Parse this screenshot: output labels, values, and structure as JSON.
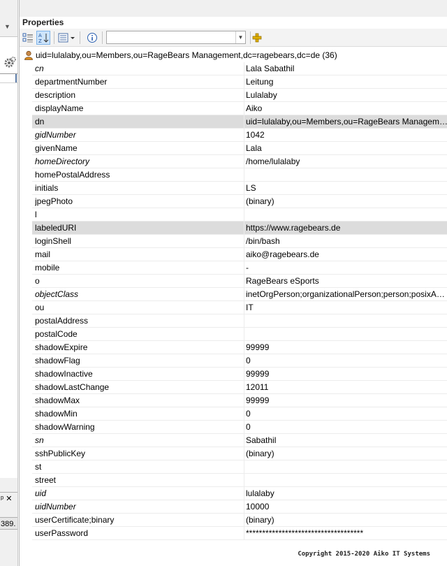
{
  "left_panel": {
    "pin_label": "ᵖ ✕",
    "status_text": "389."
  },
  "panel": {
    "title": "Properties",
    "entry_dn": "uid=lulalaby,ou=Members,ou=RageBears Management,dc=ragebears,dc=de (36)",
    "search_placeholder": ""
  },
  "attributes": [
    {
      "name": "cn",
      "value": "Lala Sabathil",
      "italic": true
    },
    {
      "name": "departmentNumber",
      "value": "Leitung"
    },
    {
      "name": "description",
      "value": "Lulalaby"
    },
    {
      "name": "displayName",
      "value": "Aiko"
    },
    {
      "name": "dn",
      "value": "uid=lulalaby,ou=Members,ou=RageBears Manageme...",
      "selected": true
    },
    {
      "name": "gidNumber",
      "value": "1042",
      "italic": true
    },
    {
      "name": "givenName",
      "value": "Lala"
    },
    {
      "name": "homeDirectory",
      "value": "/home/lulalaby",
      "italic": true
    },
    {
      "name": "homePostalAddress",
      "value": ""
    },
    {
      "name": "initials",
      "value": "LS"
    },
    {
      "name": "jpegPhoto",
      "value": "(binary)"
    },
    {
      "name": "l",
      "value": ""
    },
    {
      "name": "labeledURI",
      "value": "https://www.ragebears.de",
      "selected": true
    },
    {
      "name": "loginShell",
      "value": "/bin/bash"
    },
    {
      "name": "mail",
      "value": "aiko@ragebears.de"
    },
    {
      "name": "mobile",
      "value": "-"
    },
    {
      "name": "o",
      "value": "RageBears eSports"
    },
    {
      "name": "objectClass",
      "value": "inetOrgPerson;organizationalPerson;person;posixAccou",
      "italic": true
    },
    {
      "name": "ou",
      "value": "IT"
    },
    {
      "name": "postalAddress",
      "value": ""
    },
    {
      "name": "postalCode",
      "value": ""
    },
    {
      "name": "shadowExpire",
      "value": "99999"
    },
    {
      "name": "shadowFlag",
      "value": "0"
    },
    {
      "name": "shadowInactive",
      "value": "99999"
    },
    {
      "name": "shadowLastChange",
      "value": "12011"
    },
    {
      "name": "shadowMax",
      "value": "99999"
    },
    {
      "name": "shadowMin",
      "value": "0"
    },
    {
      "name": "shadowWarning",
      "value": "0"
    },
    {
      "name": "sn",
      "value": "Sabathil",
      "italic": true
    },
    {
      "name": "sshPublicKey",
      "value": "(binary)"
    },
    {
      "name": "st",
      "value": ""
    },
    {
      "name": "street",
      "value": ""
    },
    {
      "name": "uid",
      "value": "lulalaby",
      "italic": true
    },
    {
      "name": "uidNumber",
      "value": "10000",
      "italic": true
    },
    {
      "name": "userCertificate;binary",
      "value": "(binary)"
    },
    {
      "name": "userPassword",
      "value": "************************************"
    }
  ],
  "footer": "Copyright 2015-2020 Aiko IT Systems",
  "colors": {
    "selected_row": "#dcdcdc",
    "accent": "#7eb4ea"
  }
}
